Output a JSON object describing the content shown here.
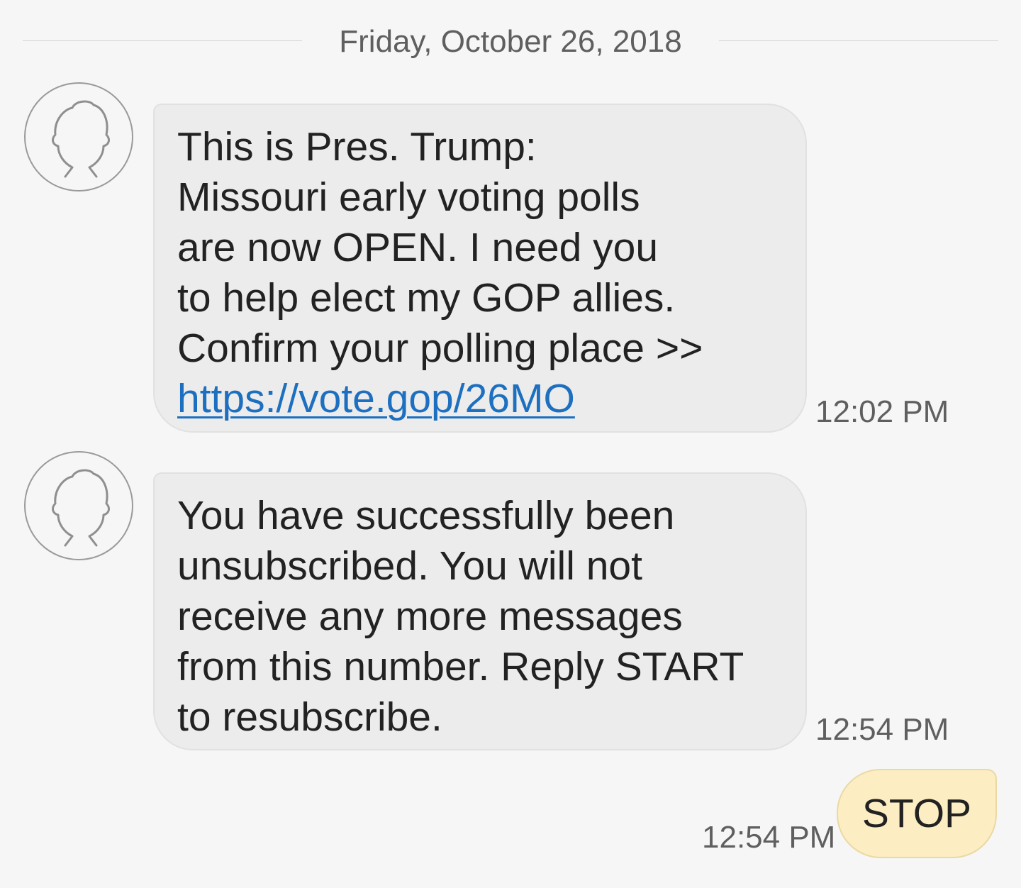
{
  "conversation": {
    "date_label": "Friday, October 26, 2018",
    "messages": [
      {
        "direction": "incoming",
        "avatar_icon": "person-outline-icon",
        "lines": [
          "This is Pres. Trump:",
          "Missouri early voting polls",
          "are now OPEN. I need you",
          "to help elect my GOP allies.",
          "Confirm your polling place >>"
        ],
        "link": "https://vote.gop/26MO",
        "time": "12:02 PM"
      },
      {
        "direction": "incoming",
        "avatar_icon": "person-outline-icon",
        "lines": [
          "You have successfully been",
          "unsubscribed. You will not",
          "receive any more messages",
          "from this number. Reply START",
          "to resubscribe."
        ],
        "time": "12:54 PM"
      },
      {
        "direction": "outgoing",
        "text": "STOP",
        "time": "12:54 PM"
      }
    ]
  },
  "colors": {
    "background": "#f6f6f6",
    "incoming_bubble": "#ececec",
    "outgoing_bubble": "#fcedc3",
    "link": "#1d6fc0",
    "timestamp": "#5f5f5f"
  }
}
